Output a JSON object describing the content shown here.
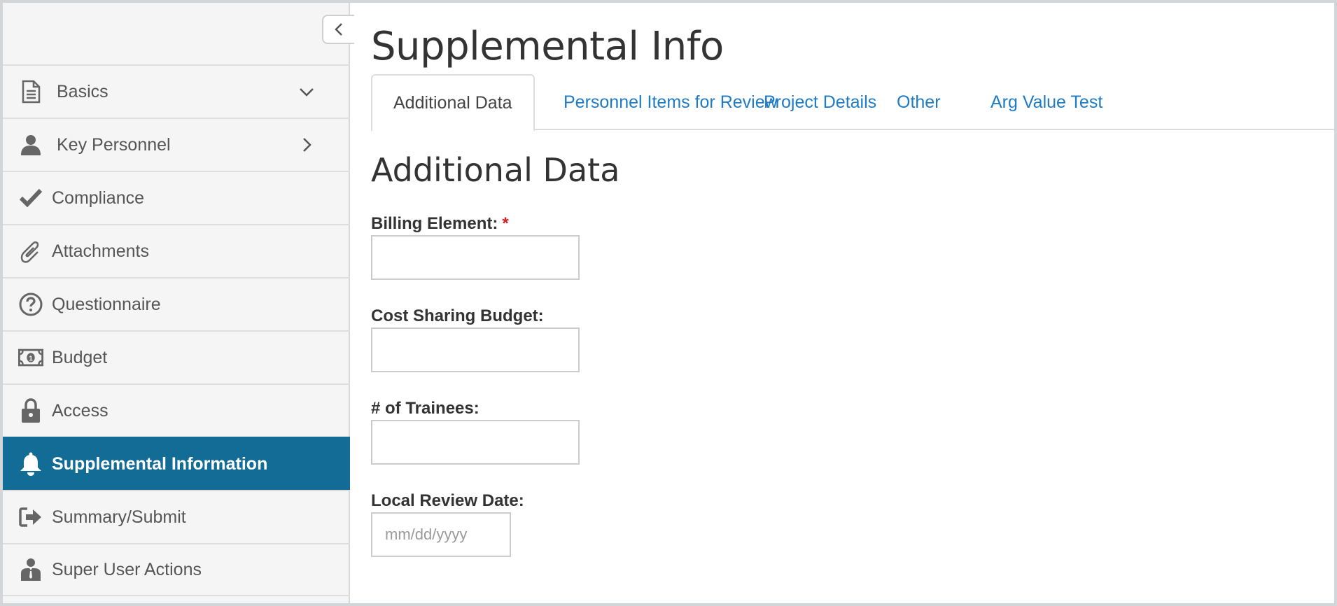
{
  "sidebar": {
    "items": [
      {
        "label": "Basics",
        "icon": "document-icon",
        "chevron": "down"
      },
      {
        "label": "Key Personnel",
        "icon": "person-icon",
        "chevron": "right"
      },
      {
        "label": "Compliance",
        "icon": "checkmark-icon"
      },
      {
        "label": "Attachments",
        "icon": "paperclip-icon"
      },
      {
        "label": "Questionnaire",
        "icon": "question-circle-icon"
      },
      {
        "label": "Budget",
        "icon": "money-icon"
      },
      {
        "label": "Access",
        "icon": "lock-icon"
      },
      {
        "label": "Supplemental Information",
        "icon": "bell-icon",
        "active": true
      },
      {
        "label": "Summary/Submit",
        "icon": "sign-out-icon"
      },
      {
        "label": "Super User Actions",
        "icon": "user-tie-icon"
      }
    ]
  },
  "page": {
    "title": "Supplemental Info",
    "tabs": [
      {
        "label": "Additional Data",
        "active": true
      },
      {
        "label": "Personnel Items for Review"
      },
      {
        "label": "Project Details"
      },
      {
        "label": "Other"
      },
      {
        "label": "Arg Value Test"
      }
    ],
    "section_title": "Additional Data"
  },
  "form": {
    "billing_element": {
      "label": "Billing Element:",
      "required_mark": "*",
      "value": ""
    },
    "cost_sharing_budget": {
      "label": "Cost Sharing Budget:",
      "value": ""
    },
    "trainees": {
      "label": "# of Trainees:",
      "value": ""
    },
    "local_review_date": {
      "label": "Local Review Date:",
      "placeholder": "mm/dd/yyyy",
      "value": ""
    }
  },
  "colors": {
    "accent": "#136c95",
    "link": "#1f7bc4",
    "required": "#d61f1f"
  }
}
